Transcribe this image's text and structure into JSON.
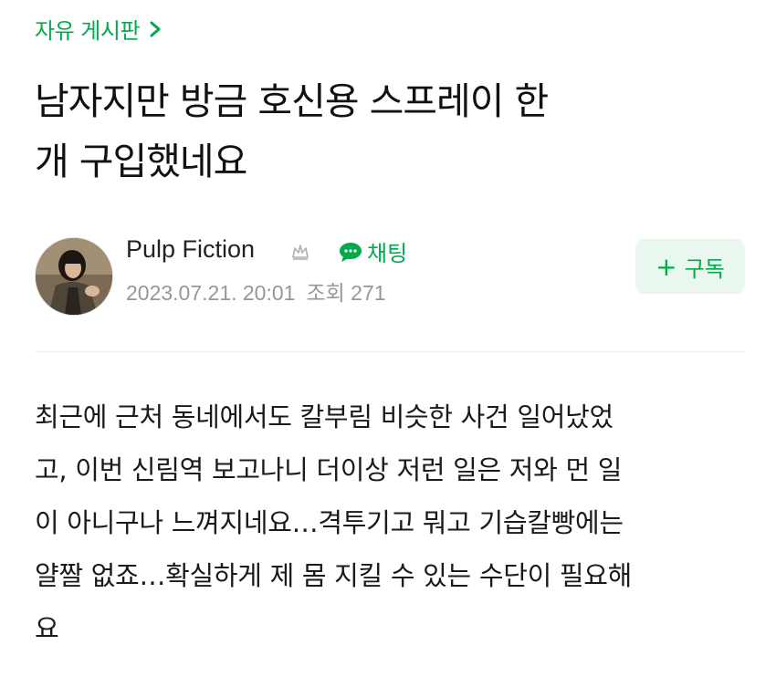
{
  "board": {
    "label": "자유 게시판",
    "icon": "chevron-right-icon",
    "accent": "#03a94d"
  },
  "post": {
    "title_lines": [
      "남자지만 방금 호신용 스프레이 한",
      "개 구입했네요"
    ],
    "author": {
      "nickname": "Pulp Fiction",
      "badge_icon": "crown-icon",
      "chat_label": "채팅",
      "avatar_icon": "profile-photo"
    },
    "date": "2023.07.21. 20:01",
    "views": "조회 271",
    "subscribe_label": "구독",
    "body_lines": [
      "최근에 근처 동네에서도 칼부림 비슷한 사건 일어났었",
      "고, 이번 신림역 보고나니 더이상 저런 일은 저와 먼 일",
      "이 아니구나 느껴지네요…격투기고 뭐고 기습칼빵에는",
      "얄짤 없죠…확실하게 제 몸 지킬 수 있는 수단이 필요해",
      "요"
    ]
  }
}
